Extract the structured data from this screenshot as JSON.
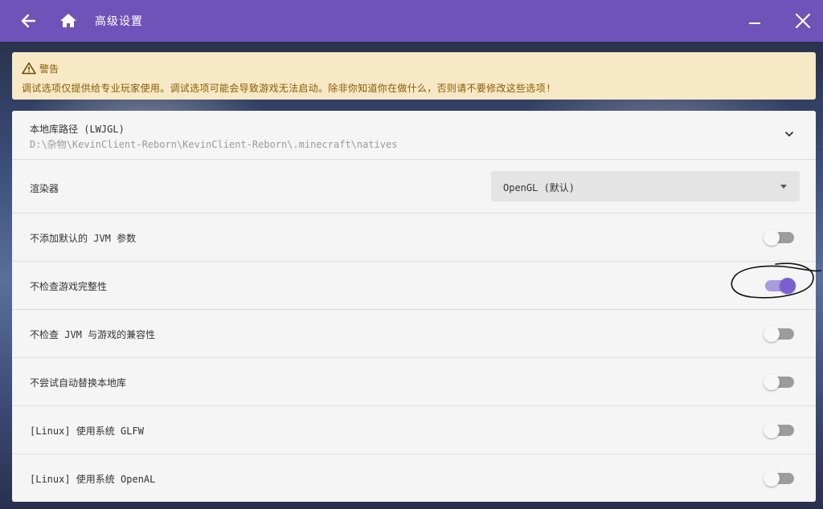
{
  "titlebar": {
    "title": "高级设置",
    "back_icon": "arrow-left-icon",
    "home_icon": "home-icon",
    "minimize_icon": "minimize-icon",
    "close_icon": "close-icon",
    "color": "#6f53b8"
  },
  "warning": {
    "title": "警告",
    "icon": "warning-triangle-icon",
    "text": "调试选项仅提供给专业玩家使用。调试选项可能会导致游戏无法启动。除非你知道你在做什么，否则请不要修改这些选项!",
    "color": "#f7e9c6"
  },
  "settings": {
    "native_path": {
      "label": "本地库路径 (LWJGL)",
      "value": "D:\\杂物\\KevinClient-Reborn\\KevinClient-Reborn\\.minecraft\\natives"
    },
    "renderer": {
      "label": "渲染器",
      "selected": "OpenGL (默认)"
    },
    "toggles": [
      {
        "label": "不添加默认的 JVM 参数",
        "on": false
      },
      {
        "label": "不检查游戏完整性",
        "on": true
      },
      {
        "label": "不检查 JVM 与游戏的兼容性",
        "on": false
      },
      {
        "label": "不尝试自动替换本地库",
        "on": false
      },
      {
        "label": "[Linux] 使用系统 GLFW",
        "on": false
      },
      {
        "label": "[Linux] 使用系统 OpenAL",
        "on": false
      }
    ]
  },
  "accent_color": "#7a5fd0"
}
